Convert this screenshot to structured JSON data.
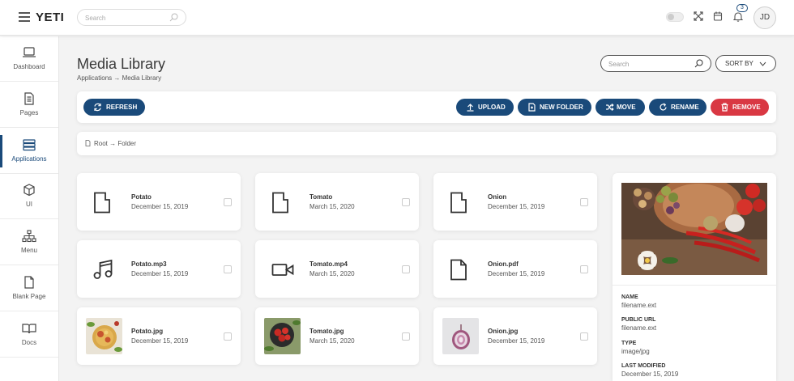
{
  "app": {
    "logo": "YETI"
  },
  "top_search": {
    "placeholder": "Search"
  },
  "notifications": {
    "count": "3"
  },
  "user": {
    "initials": "JD"
  },
  "sidebar": {
    "items": [
      {
        "label": "Dashboard",
        "icon": "laptop-icon"
      },
      {
        "label": "Pages",
        "icon": "document-icon"
      },
      {
        "label": "Applications",
        "icon": "archive-icon",
        "active": true
      },
      {
        "label": "UI",
        "icon": "cube-icon"
      },
      {
        "label": "Menu",
        "icon": "sitemap-icon"
      },
      {
        "label": "Blank Page",
        "icon": "file-icon"
      },
      {
        "label": "Docs",
        "icon": "book-icon"
      }
    ]
  },
  "header": {
    "title": "Media Library",
    "breadcrumb": [
      "Applications",
      "Media Library"
    ],
    "search_placeholder": "Search",
    "sort_label": "SORT BY"
  },
  "toolbar": {
    "refresh": "REFRESH",
    "upload": "UPLOAD",
    "new_folder": "NEW FOLDER",
    "move": "MOVE",
    "rename": "RENAME",
    "remove": "REMOVE"
  },
  "path": {
    "text": "Root → Folder"
  },
  "files": [
    {
      "name": "Potato",
      "date": "December 15, 2019",
      "kind": "folder"
    },
    {
      "name": "Tomato",
      "date": "March 15, 2020",
      "kind": "folder"
    },
    {
      "name": "Onion",
      "date": "December 15, 2019",
      "kind": "folder"
    },
    {
      "name": "Potato.mp3",
      "date": "December 15, 2019",
      "kind": "audio"
    },
    {
      "name": "Tomato.mp4",
      "date": "March 15, 2020",
      "kind": "video"
    },
    {
      "name": "Onion.pdf",
      "date": "December 15, 2019",
      "kind": "pdf"
    },
    {
      "name": "Potato.jpg",
      "date": "December 15, 2019",
      "kind": "image"
    },
    {
      "name": "Tomato.jpg",
      "date": "March 15, 2020",
      "kind": "image"
    },
    {
      "name": "Onion.jpg",
      "date": "December 15, 2019",
      "kind": "image"
    }
  ],
  "details": {
    "name_label": "NAME",
    "name_value": "filename.ext",
    "url_label": "PUBLIC URL",
    "url_value": "filename.ext",
    "type_label": "TYPE",
    "type_value": "image/jpg",
    "modified_label": "LAST MODIFIED",
    "modified_value": "December 15, 2019"
  },
  "colors": {
    "primary": "#1a4a7a",
    "danger": "#d93843",
    "background": "#f3f3f3"
  }
}
